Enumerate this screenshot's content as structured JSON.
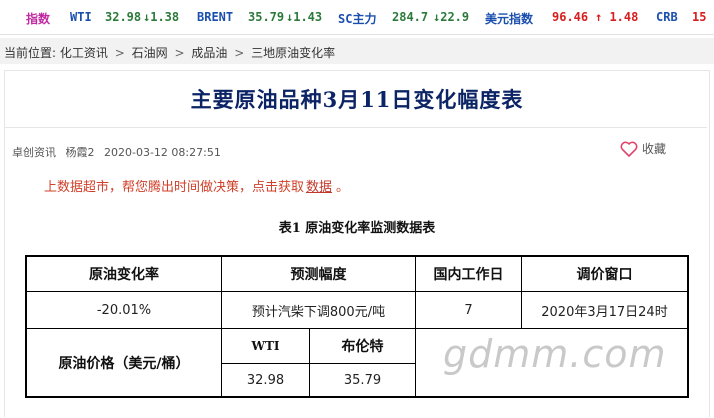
{
  "ticker": {
    "index_label": "指数",
    "wti_label": "WTI",
    "wti_value": "32.98",
    "wti_change": "↓1.38",
    "brent_label": "BRENT",
    "brent_value": "35.79",
    "brent_change": "↓1.43",
    "sc_label": "SC主力",
    "sc_value": "284.7",
    "sc_change": "↓22.9",
    "usd_label": "美元指数",
    "usd_value": "96.46",
    "usd_change": "↑ 1.48",
    "crb_label": "CRB",
    "crb_value": "15"
  },
  "breadcrumb": {
    "prefix": "当前位置:",
    "items": [
      "化工资讯",
      "石油网",
      "成品油",
      "三地原油变化率"
    ],
    "separator": ">"
  },
  "article": {
    "title": "主要原油品种3月11日变化幅度表",
    "source": "卓创资讯",
    "author": "杨霞2",
    "datetime": "2020-03-12 08:27:51",
    "favorite_label": "收藏",
    "promo_text": "上数据超市，帮您腾出时间做决策，点击获取",
    "promo_link": "数据",
    "promo_end": "。",
    "table_caption": "表1   原油变化率监测数据表"
  },
  "table": {
    "headers": [
      "原油变化率",
      "预测幅度",
      "国内工作日",
      "调价窗口"
    ],
    "row1": [
      "-20.01%",
      "预计汽柴下调800元/吨",
      "7",
      "2020年3月17日24时"
    ],
    "price_label": "原油价格（美元/桶）",
    "price_headers": [
      "WTI",
      "布伦特"
    ],
    "price_values": [
      "32.98",
      "35.79"
    ]
  },
  "watermark": "gdmm.com",
  "colors": {
    "title": "#0c2466",
    "promo": "#d0402a",
    "up": "#d81e1e",
    "down": "#2c7a3a",
    "label": "#1a4fae"
  }
}
